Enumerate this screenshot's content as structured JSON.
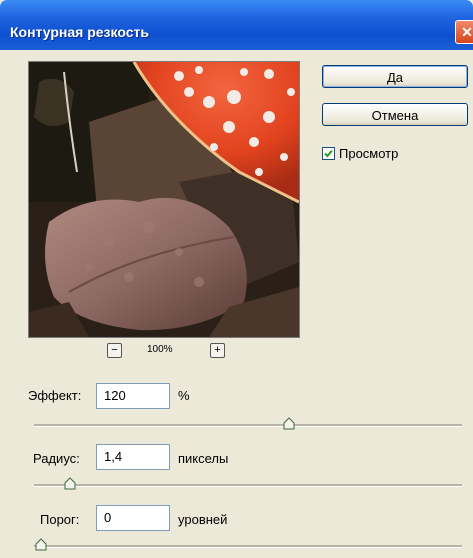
{
  "window": {
    "title": "Контурная резкость",
    "close_glyph": "✕"
  },
  "buttons": {
    "ok_label": "Да",
    "cancel_label": "Отмена"
  },
  "preview": {
    "checkbox_label": "Просмотр",
    "checked": true,
    "zoom_minus_glyph": "−",
    "zoom_plus_glyph": "+",
    "zoom_level": "100%"
  },
  "fields": {
    "effect": {
      "label": "Эффект:",
      "value": "120",
      "unit": "%",
      "slider_fraction": 0.6
    },
    "radius": {
      "label": "Радиус:",
      "value": "1,4",
      "unit": "пикселы",
      "slider_fraction": 0.07
    },
    "threshold": {
      "label": "Порог:",
      "value": "0",
      "unit": "уровней",
      "slider_fraction": 0.0
    }
  },
  "colors": {
    "titlebar": "#0d4fd0",
    "dialog_bg": "#ece9d8",
    "mushroom_cap": "#e8482a"
  }
}
